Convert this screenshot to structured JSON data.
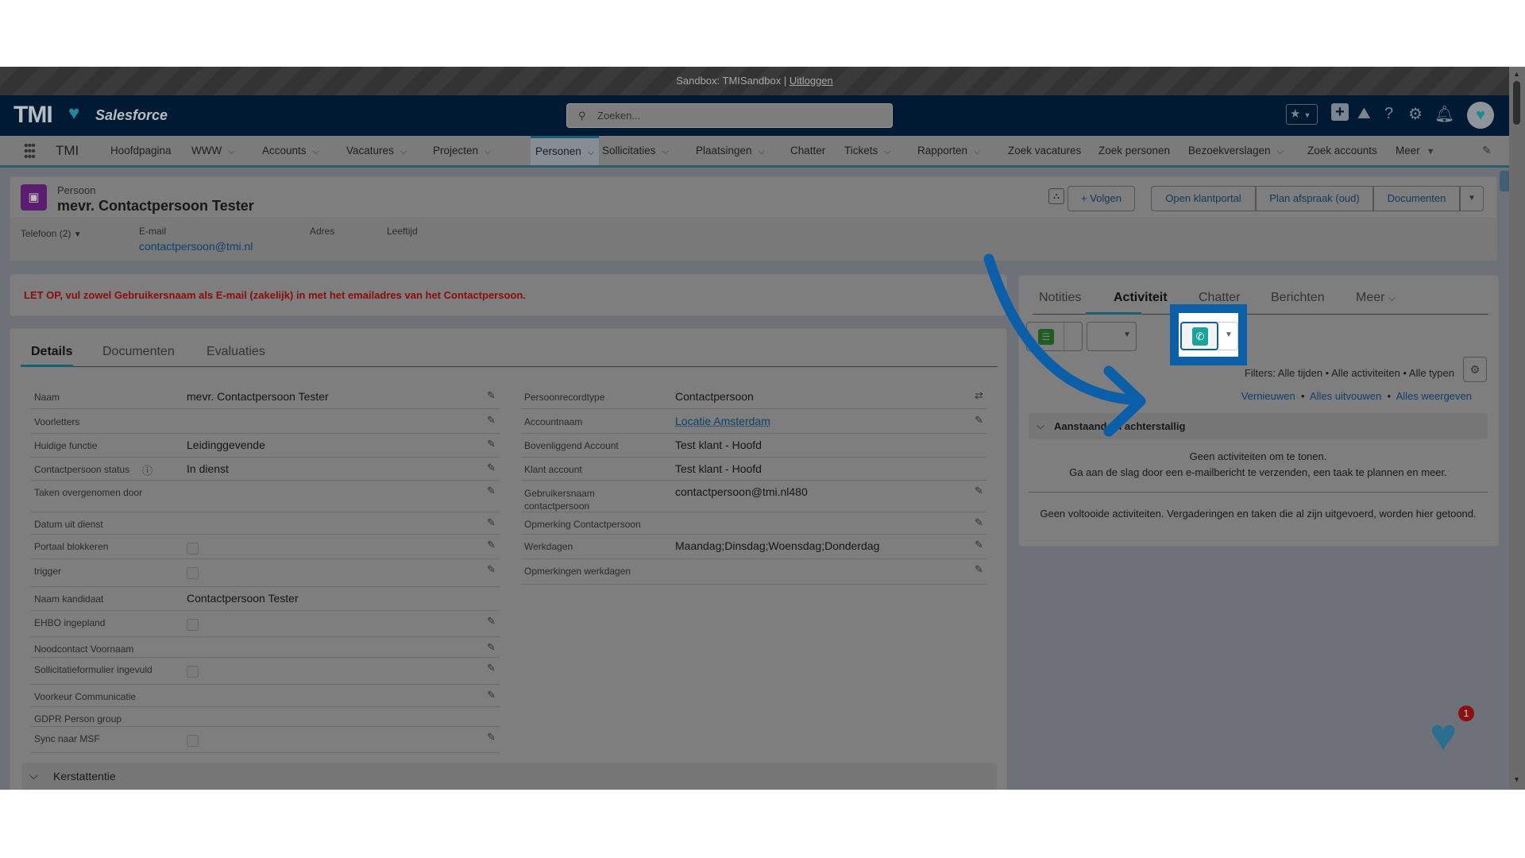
{
  "sandbox": {
    "text": "Sandbox: TMISandbox |",
    "logout": "Uitloggen"
  },
  "header": {
    "logo": "TMI",
    "logo_sub": "Salesforce",
    "search_placeholder": "Zoeken...",
    "icons": [
      "favorites-star-icon",
      "add-icon",
      "trailhead-icon",
      "help-icon",
      "setup-gear-icon",
      "notifications-bell-icon",
      "avatar"
    ]
  },
  "nav": {
    "app": "TMI",
    "items": [
      {
        "label": "Hoofdpagina",
        "dropdown": false
      },
      {
        "label": "WWW",
        "dropdown": true
      },
      {
        "label": "Accounts",
        "dropdown": true
      },
      {
        "label": "Vacatures",
        "dropdown": true
      },
      {
        "label": "Projecten",
        "dropdown": true
      },
      {
        "label": "Personen",
        "dropdown": true,
        "active": true
      },
      {
        "label": "Sollicitaties",
        "dropdown": true
      },
      {
        "label": "Plaatsingen",
        "dropdown": true
      },
      {
        "label": "Chatter",
        "dropdown": false
      },
      {
        "label": "Tickets",
        "dropdown": true
      },
      {
        "label": "Rapporten",
        "dropdown": true
      },
      {
        "label": "Zoek vacatures",
        "dropdown": false
      },
      {
        "label": "Zoek personen",
        "dropdown": false
      },
      {
        "label": "Bezoekverslagen",
        "dropdown": true
      },
      {
        "label": "Zoek accounts",
        "dropdown": false
      },
      {
        "label": "Meer",
        "dropdown": true
      }
    ]
  },
  "record": {
    "type": "Persoon",
    "name": "mevr. Contactpersoon Tester",
    "actions": {
      "follow": "Volgen",
      "portal": "Open klantportal",
      "plan": "Plan afspraak (oud)",
      "docs": "Documenten"
    },
    "highlights": {
      "phone": "Telefoon (2)",
      "email_label": "E-mail",
      "email": "contactpersoon@tmi.nl",
      "address_label": "Adres",
      "age_label": "Leeftijd"
    }
  },
  "warning": "LET OP, vul zowel Gebruikersnaam als E-mail (zakelijk) in met het emailadres van het Contactpersoon.",
  "details": {
    "tabs": [
      "Details",
      "Documenten",
      "Evaluaties"
    ],
    "left": [
      {
        "label": "Naam",
        "value": "mevr. Contactpersoon Tester",
        "editable": true
      },
      {
        "label": "Voorletters",
        "value": "",
        "editable": true
      },
      {
        "label": "Huidige functie",
        "value": "Leidinggevende",
        "editable": true
      },
      {
        "label": "Contactpersoon status",
        "value": "In dienst",
        "editable": true,
        "info": true
      },
      {
        "label": "Taken overgenomen door",
        "value": "",
        "editable": true
      },
      {
        "label": "Datum uit dienst",
        "value": "",
        "editable": true
      },
      {
        "label": "Portaal blokkeren",
        "checkbox": false,
        "editable": true
      },
      {
        "label": "trigger",
        "checkbox": false,
        "editable": true
      },
      {
        "label": "Naam kandidaat",
        "value": "Contactpersoon Tester",
        "editable": false
      },
      {
        "label": "EHBO ingepland",
        "checkbox": false,
        "editable": true
      },
      {
        "label": "Noodcontact Voornaam",
        "value": "",
        "editable": true
      },
      {
        "label": "Sollicitatieformulier ingevuld",
        "checkbox": false,
        "editable": true
      },
      {
        "label": "Voorkeur Communicatie",
        "value": "",
        "editable": true
      },
      {
        "label": "GDPR Person group",
        "value": "",
        "editable": false
      },
      {
        "label": "Sync naar MSF",
        "checkbox": false,
        "editable": true
      }
    ],
    "right": [
      {
        "label": "Persoonrecordtype",
        "value": "Contactpersoon",
        "editable": "change"
      },
      {
        "label": "Accountnaam",
        "value": "Locatie Amsterdam",
        "link": true,
        "editable": true
      },
      {
        "label": "Bovenliggend Account",
        "value": "Test klant - Hoofd",
        "editable": false
      },
      {
        "label": "Klant account",
        "value": "Test klant - Hoofd",
        "editable": false
      },
      {
        "label": "Gebruikersnaam contactpersoon",
        "value": "contactpersoon@tmi.nl480",
        "editable": true
      },
      {
        "label": "Opmerking Contactpersoon",
        "value": "",
        "editable": true
      },
      {
        "label": "Werkdagen",
        "value": "Maandag;Dinsdag;Woensdag;Donderdag",
        "editable": true
      },
      {
        "label": "Opmerkingen werkdagen",
        "value": "",
        "editable": true
      }
    ],
    "section": "Kerstattentie"
  },
  "activity": {
    "tabs": [
      "Notities",
      "Activiteit",
      "Chatter",
      "Berichten",
      "Meer"
    ],
    "active_tab": "Activiteit",
    "filters": "Filters: Alle tijden • Alle activiteiten • Alle typen",
    "links": [
      "Vernieuwen",
      "Alles uitvouwen",
      "Alles weergeven"
    ],
    "upcoming": "Aanstaand en achterstallig",
    "empty1": "Geen activiteiten om te tonen.",
    "empty2": "Ga aan de slag door een e-mailbericht te verzenden, een taak te plannen en meer.",
    "completed": "Geen voltooide activiteiten. Vergaderingen en taken die al zijn uitgevoerd, worden hier getoond."
  },
  "highlight_color": "#0b5ea8",
  "call_icon_color": "#1aa39a",
  "widget_badge": "1"
}
